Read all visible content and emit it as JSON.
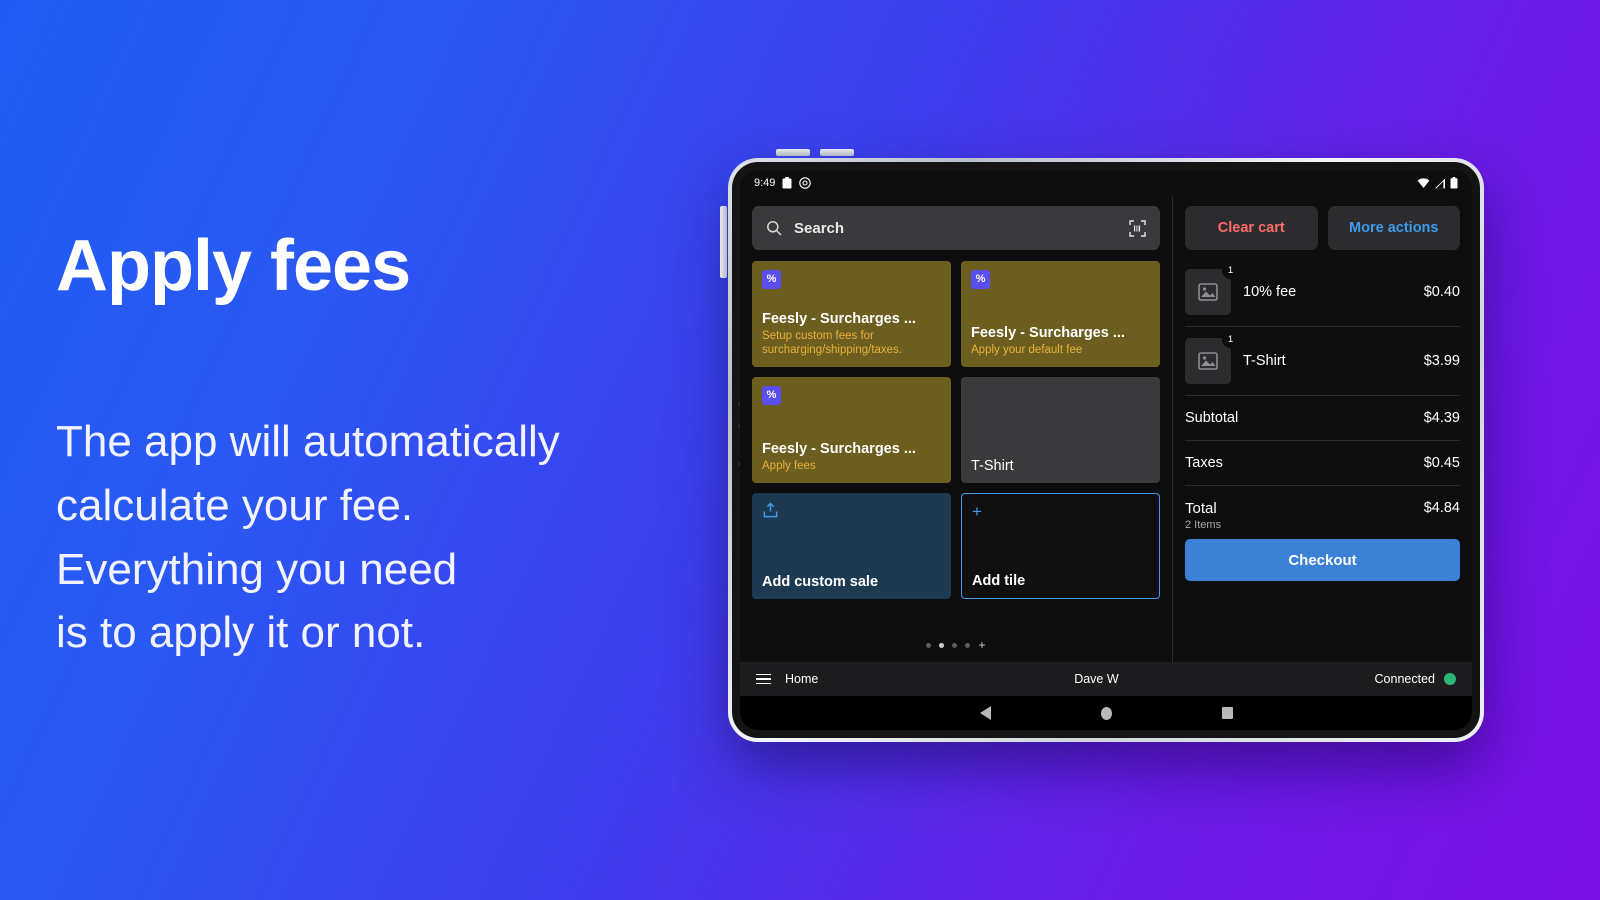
{
  "marketing": {
    "headline": "Apply fees",
    "body_lines": [
      "The app will automatically",
      "calculate your fee.",
      "Everything you need",
      "is to apply it or not."
    ]
  },
  "device": {
    "status_bar": {
      "time": "9:49",
      "left_icons": [
        "clipboard-icon",
        "do-not-disturb-icon"
      ],
      "right_icons": [
        "wifi-icon",
        "cellular-signal-icon",
        "battery-icon"
      ]
    }
  },
  "search": {
    "placeholder": "Search",
    "icon": "search-icon",
    "scan_icon": "barcode-scan-icon"
  },
  "tiles": [
    {
      "badge": "%",
      "badge_icon": "percent-badge-icon",
      "title": "Feesly - Surcharges ...",
      "subtitle": "Setup custom fees for surcharging/shipping/taxes.",
      "style": "fee"
    },
    {
      "badge": "%",
      "badge_icon": "percent-badge-icon",
      "title": "Feesly - Surcharges ...",
      "subtitle": "Apply your default fee",
      "style": "fee"
    },
    {
      "badge": "%",
      "badge_icon": "percent-badge-icon",
      "title": "Feesly - Surcharges ...",
      "subtitle": "Apply fees",
      "style": "fee"
    },
    {
      "badge": "",
      "badge_icon": "",
      "title": "T-Shirt",
      "subtitle": "",
      "style": "plain"
    },
    {
      "badge": "",
      "badge_icon": "upload-icon",
      "title": "Add custom sale",
      "subtitle": "",
      "style": "custom"
    },
    {
      "badge": "",
      "badge_icon": "plus-icon",
      "title": "Add tile",
      "subtitle": "",
      "style": "addtile"
    }
  ],
  "pager": {
    "dots": 4,
    "active_index": 1,
    "add_glyph": "+"
  },
  "cart": {
    "clear_label": "Clear cart",
    "more_actions_label": "More actions",
    "lines": [
      {
        "qty": "1",
        "name": "10% fee",
        "price": "$0.40",
        "thumb_icon": "image-placeholder-icon"
      },
      {
        "qty": "1",
        "name": "T-Shirt",
        "price": "$3.99",
        "thumb_icon": "image-placeholder-icon"
      }
    ],
    "subtotal_label": "Subtotal",
    "subtotal_value": "$4.39",
    "taxes_label": "Taxes",
    "taxes_value": "$0.45",
    "total_label": "Total",
    "total_items": "2 Items",
    "total_value": "$4.84",
    "checkout_label": "Checkout"
  },
  "appbar": {
    "menu_icon": "hamburger-menu-icon",
    "home_label": "Home",
    "user_label": "Dave W",
    "status_label": "Connected",
    "status_color": "#2bb673"
  },
  "navbar": {
    "back": "back-triangle-icon",
    "home": "home-circle-icon",
    "recents": "recents-square-icon"
  },
  "colors": {
    "bg_start": "#1f5cf5",
    "bg_end": "#7a0fe6",
    "accent_blue": "#3d9bf0",
    "checkout_blue": "#3b82d6",
    "danger_red": "#ff6b6b",
    "fee_tile": "#6b5e1f",
    "fee_text": "#ecb23a",
    "badge_purple": "#5b4ef0"
  }
}
